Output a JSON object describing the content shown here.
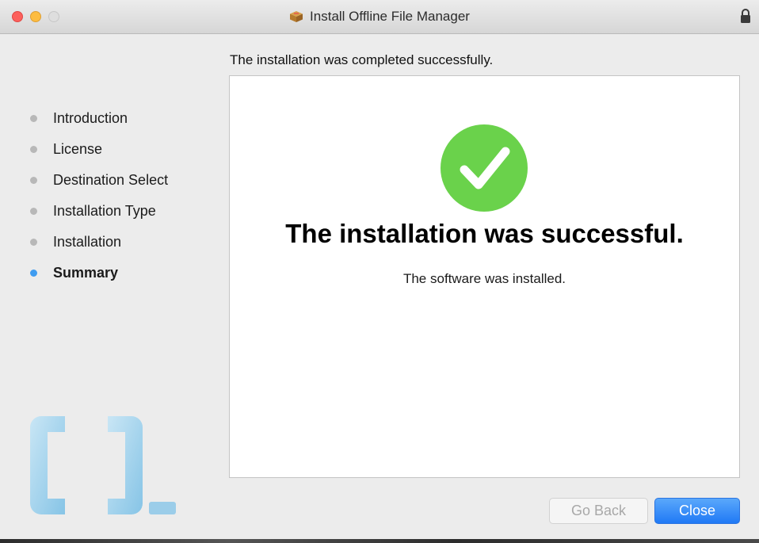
{
  "window": {
    "title": "Install Offline File Manager"
  },
  "header": {
    "text": "The installation was completed successfully."
  },
  "sidebar": {
    "steps": [
      {
        "label": "Introduction",
        "active": false
      },
      {
        "label": "License",
        "active": false
      },
      {
        "label": "Destination Select",
        "active": false
      },
      {
        "label": "Installation Type",
        "active": false
      },
      {
        "label": "Installation",
        "active": false
      },
      {
        "label": "Summary",
        "active": true
      }
    ]
  },
  "main": {
    "success_title": "The installation was successful.",
    "success_message": "The software was installed."
  },
  "buttons": {
    "back_label": "Go Back",
    "close_label": "Close"
  },
  "icons": {
    "app": "package-icon",
    "lock": "lock-icon",
    "status": "success-checkmark-icon"
  },
  "colors": {
    "accent": "#3f9cf0",
    "success": "#6ad24b",
    "primary_button": "#2079f5"
  }
}
